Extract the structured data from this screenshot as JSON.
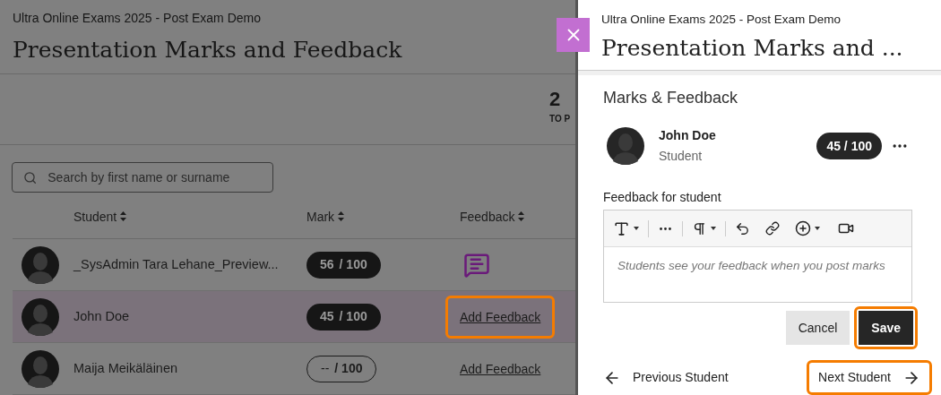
{
  "page": {
    "course": "Ultra Online Exams 2025 - Post Exam Demo",
    "title": "Presentation Marks and Feedback",
    "stat": {
      "value": "2",
      "label": "TO P"
    },
    "search": {
      "placeholder": "Search by first name or surname"
    },
    "table": {
      "columns": [
        "Student",
        "Mark",
        "Feedback"
      ],
      "rows": [
        {
          "student": "_SysAdmin Tara Lehane_Preview...",
          "mark": "56",
          "total": "/ 100",
          "graded": true,
          "feedback": {
            "kind": "icon"
          },
          "selected": false
        },
        {
          "student": "John Doe",
          "mark": "45",
          "total": "/ 100",
          "graded": true,
          "feedback": {
            "kind": "link",
            "label": "Add Feedback",
            "highlighted": true
          },
          "selected": true
        },
        {
          "student": "Maija Meikäläinen",
          "mark": "--",
          "total": "/ 100",
          "graded": false,
          "feedback": {
            "kind": "link",
            "label": "Add Feedback",
            "highlighted": false
          },
          "selected": false
        }
      ]
    }
  },
  "panel": {
    "course": "Ultra Online Exams 2025 - Post Exam Demo",
    "title": "Presentation Marks and ...",
    "section": "Marks & Feedback",
    "student": {
      "name": "John Doe",
      "role": "Student",
      "mark": "45 / 100"
    },
    "feedback": {
      "label": "Feedback for student",
      "placeholder": "Students see your feedback when you post marks"
    },
    "buttons": [
      {
        "kind": "secondary",
        "label": "Cancel",
        "highlighted": false
      },
      {
        "kind": "primary",
        "label": "Save",
        "highlighted": true
      }
    ],
    "nav": [
      {
        "kind": "previous",
        "label": "Previous Student",
        "highlighted": false
      },
      {
        "kind": "next",
        "label": "Next Student",
        "highlighted": true
      }
    ]
  }
}
